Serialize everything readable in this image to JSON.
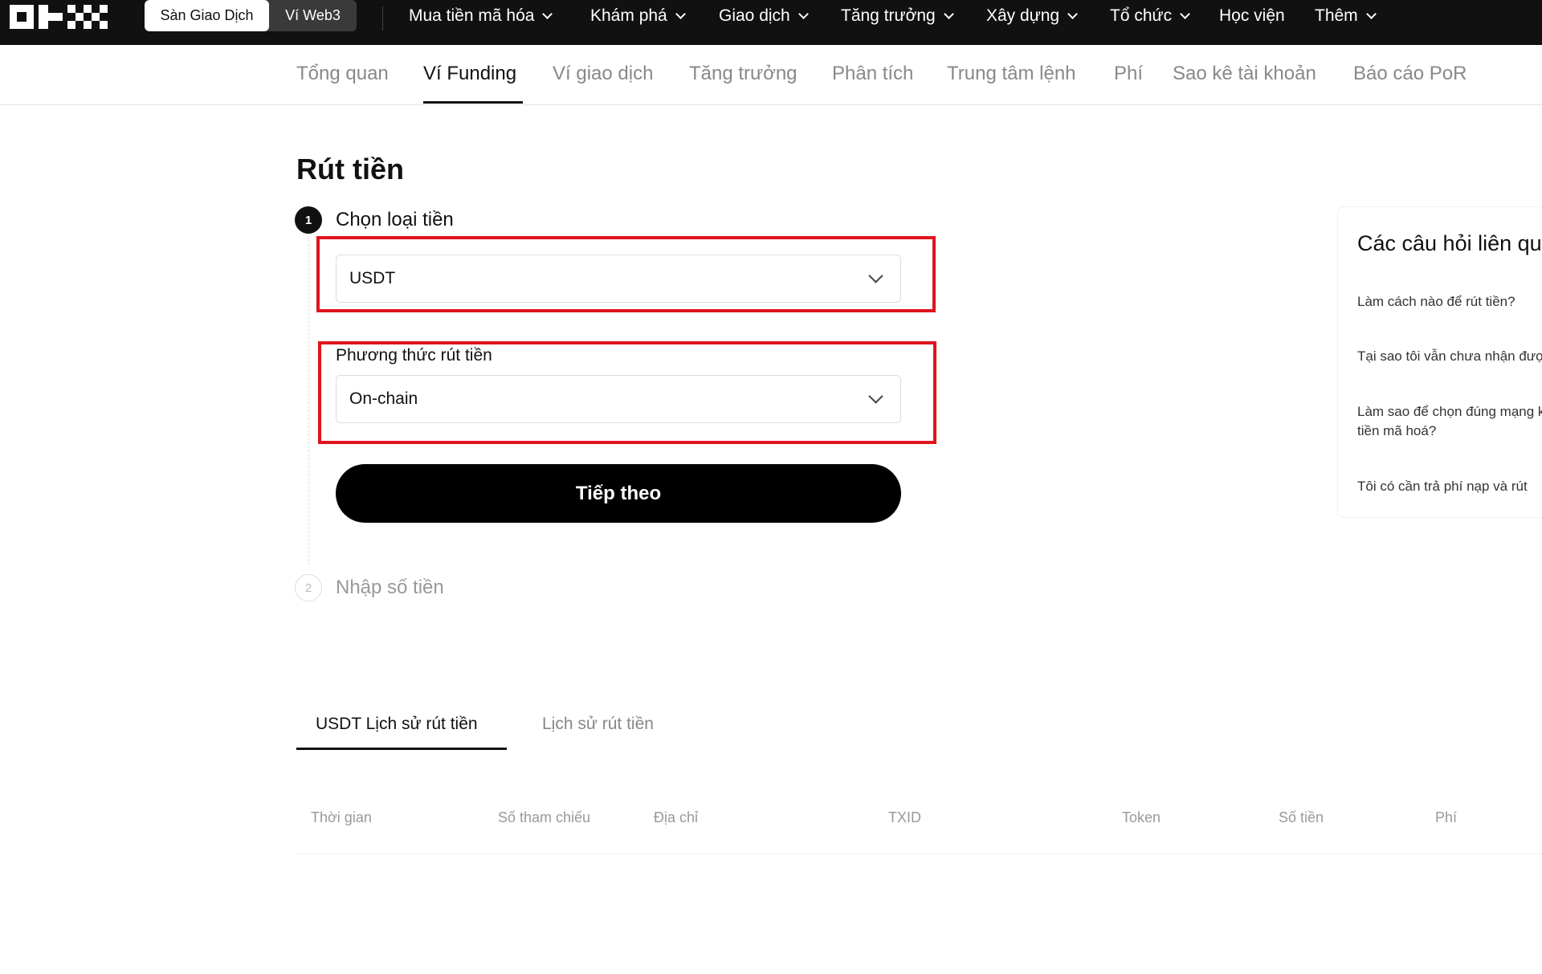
{
  "topbar": {
    "logo": "OKX",
    "toggle": [
      "Sàn Giao Dịch",
      "Ví Web3"
    ],
    "nav": [
      "Mua tiền mã hóa",
      "Khám phá",
      "Giao dịch",
      "Tăng trưởng",
      "Xây dựng",
      "Tổ chức",
      "Học viện",
      "Thêm"
    ],
    "nav_has_chevron": [
      true,
      true,
      true,
      true,
      true,
      true,
      false,
      true
    ]
  },
  "subnav": {
    "items": [
      "Tổng quan",
      "Ví Funding",
      "Ví giao dịch",
      "Tăng trưởng",
      "Phân tích",
      "Trung tâm lệnh",
      "Phí",
      "Sao kê tài khoản",
      "Báo cáo PoR"
    ],
    "active": "Ví Funding"
  },
  "page": {
    "title": "Rút tiền",
    "step1": {
      "number": "1",
      "label": "Chọn loại tiền",
      "coin_value": "USDT",
      "method_label": "Phương thức rút tiền",
      "method_value": "On-chain",
      "next_button": "Tiếp theo"
    },
    "step2": {
      "number": "2",
      "label": "Nhập số tiền"
    }
  },
  "history": {
    "tabs": [
      "USDT Lịch sử rút tiền",
      "Lịch sử rút tiền"
    ],
    "columns": [
      "Thời gian",
      "Số tham chiếu",
      "Địa chỉ",
      "TXID",
      "Token",
      "Số tiền",
      "Phí"
    ]
  },
  "faq": {
    "title": "Các câu hỏi liên quan",
    "items": [
      "Làm cách nào để rút tiền?",
      "Tại sao tôi vẫn chưa nhận được",
      "Làm sao để chọn đúng mạng khi rút tiền mã hoá?",
      "Tôi có cần trả phí nạp và rút"
    ]
  },
  "colors": {
    "highlight": "#e0141e",
    "topbar": "#111111"
  }
}
